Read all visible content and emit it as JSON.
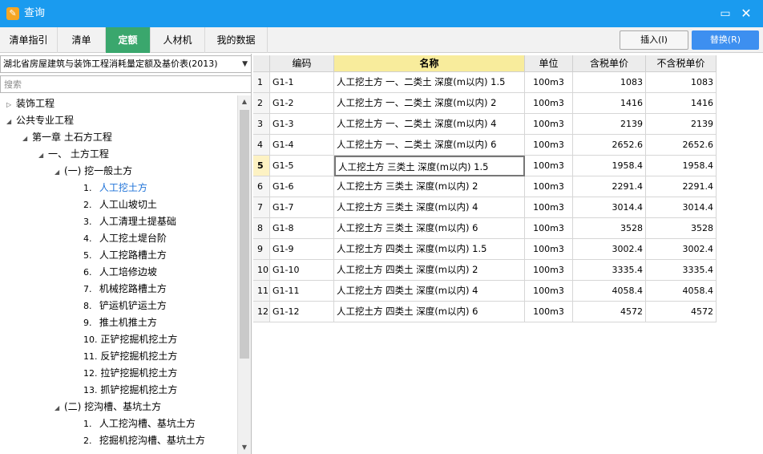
{
  "window": {
    "title": "查询",
    "icon": "app-icon",
    "minimize": "▭",
    "close": "✕"
  },
  "tabs": [
    {
      "label": "清单指引"
    },
    {
      "label": "清单"
    },
    {
      "label": "定额",
      "active": true
    },
    {
      "label": "人材机"
    },
    {
      "label": "我的数据"
    }
  ],
  "toolbar": {
    "insert_label": "插入(I)",
    "replace_label": "替换(R)"
  },
  "left": {
    "library": "湖北省房屋建筑与装饰工程消耗量定额及基价表(2013)",
    "search_placeholder": "搜索",
    "tree": [
      {
        "toggle": "▷",
        "num": "",
        "label": "装饰工程"
      },
      {
        "toggle": "◢",
        "num": "",
        "label": "公共专业工程"
      },
      {
        "toggle": "◢",
        "num": "",
        "label": "第一章 土石方工程"
      },
      {
        "toggle": "◢",
        "num": "",
        "label": "一、 土方工程"
      },
      {
        "toggle": "◢",
        "num": "",
        "label": "(一) 挖一般土方"
      },
      {
        "toggle": "",
        "num": "1.",
        "label": "人工挖土方",
        "selected": true
      },
      {
        "toggle": "",
        "num": "2.",
        "label": "人工山坡切土"
      },
      {
        "toggle": "",
        "num": "3.",
        "label": "人工清理土提基础"
      },
      {
        "toggle": "",
        "num": "4.",
        "label": "人工挖土堤台阶"
      },
      {
        "toggle": "",
        "num": "5.",
        "label": "人工挖路槽土方"
      },
      {
        "toggle": "",
        "num": "6.",
        "label": "人工培修边坡"
      },
      {
        "toggle": "",
        "num": "7.",
        "label": "机械挖路槽土方"
      },
      {
        "toggle": "",
        "num": "8.",
        "label": "铲运机铲运土方"
      },
      {
        "toggle": "",
        "num": "9.",
        "label": "推土机推土方"
      },
      {
        "toggle": "",
        "num": "10.",
        "label": "正铲挖掘机挖土方"
      },
      {
        "toggle": "",
        "num": "11.",
        "label": "反铲挖掘机挖土方"
      },
      {
        "toggle": "",
        "num": "12.",
        "label": "拉铲挖掘机挖土方"
      },
      {
        "toggle": "",
        "num": "13.",
        "label": "抓铲挖掘机挖土方"
      },
      {
        "toggle": "◢",
        "num": "",
        "label": "(二) 挖沟槽、基坑土方"
      },
      {
        "toggle": "",
        "num": "1.",
        "label": "人工挖沟槽、基坑土方"
      },
      {
        "toggle": "",
        "num": "2.",
        "label": "挖掘机挖沟槽、基坑土方"
      }
    ]
  },
  "grid": {
    "columns": [
      "编码",
      "名称",
      "单位",
      "含税单价",
      "不含税单价"
    ],
    "active_row": 4,
    "rows": [
      {
        "idx": "1",
        "code": "G1-1",
        "name": "人工挖土方 一、二类土 深度(m以内) 1.5",
        "unit": "100m3",
        "price_tax": "1083",
        "price_notax": "1083"
      },
      {
        "idx": "2",
        "code": "G1-2",
        "name": "人工挖土方 一、二类土 深度(m以内) 2",
        "unit": "100m3",
        "price_tax": "1416",
        "price_notax": "1416"
      },
      {
        "idx": "3",
        "code": "G1-3",
        "name": "人工挖土方 一、二类土 深度(m以内) 4",
        "unit": "100m3",
        "price_tax": "2139",
        "price_notax": "2139"
      },
      {
        "idx": "4",
        "code": "G1-4",
        "name": "人工挖土方 一、二类土 深度(m以内) 6",
        "unit": "100m3",
        "price_tax": "2652.6",
        "price_notax": "2652.6"
      },
      {
        "idx": "5",
        "code": "G1-5",
        "name": "人工挖土方 三类土 深度(m以内) 1.5",
        "unit": "100m3",
        "price_tax": "1958.4",
        "price_notax": "1958.4"
      },
      {
        "idx": "6",
        "code": "G1-6",
        "name": "人工挖土方 三类土 深度(m以内) 2",
        "unit": "100m3",
        "price_tax": "2291.4",
        "price_notax": "2291.4"
      },
      {
        "idx": "7",
        "code": "G1-7",
        "name": "人工挖土方 三类土 深度(m以内) 4",
        "unit": "100m3",
        "price_tax": "3014.4",
        "price_notax": "3014.4"
      },
      {
        "idx": "8",
        "code": "G1-8",
        "name": "人工挖土方 三类土 深度(m以内) 6",
        "unit": "100m3",
        "price_tax": "3528",
        "price_notax": "3528"
      },
      {
        "idx": "9",
        "code": "G1-9",
        "name": "人工挖土方 四类土 深度(m以内) 1.5",
        "unit": "100m3",
        "price_tax": "3002.4",
        "price_notax": "3002.4"
      },
      {
        "idx": "10",
        "code": "G1-10",
        "name": "人工挖土方 四类土 深度(m以内) 2",
        "unit": "100m3",
        "price_tax": "3335.4",
        "price_notax": "3335.4"
      },
      {
        "idx": "11",
        "code": "G1-11",
        "name": "人工挖土方 四类土 深度(m以内) 4",
        "unit": "100m3",
        "price_tax": "4058.4",
        "price_notax": "4058.4"
      },
      {
        "idx": "12",
        "code": "G1-12",
        "name": "人工挖土方 四类土 深度(m以内) 6",
        "unit": "100m3",
        "price_tax": "4572",
        "price_notax": "4572"
      }
    ]
  }
}
